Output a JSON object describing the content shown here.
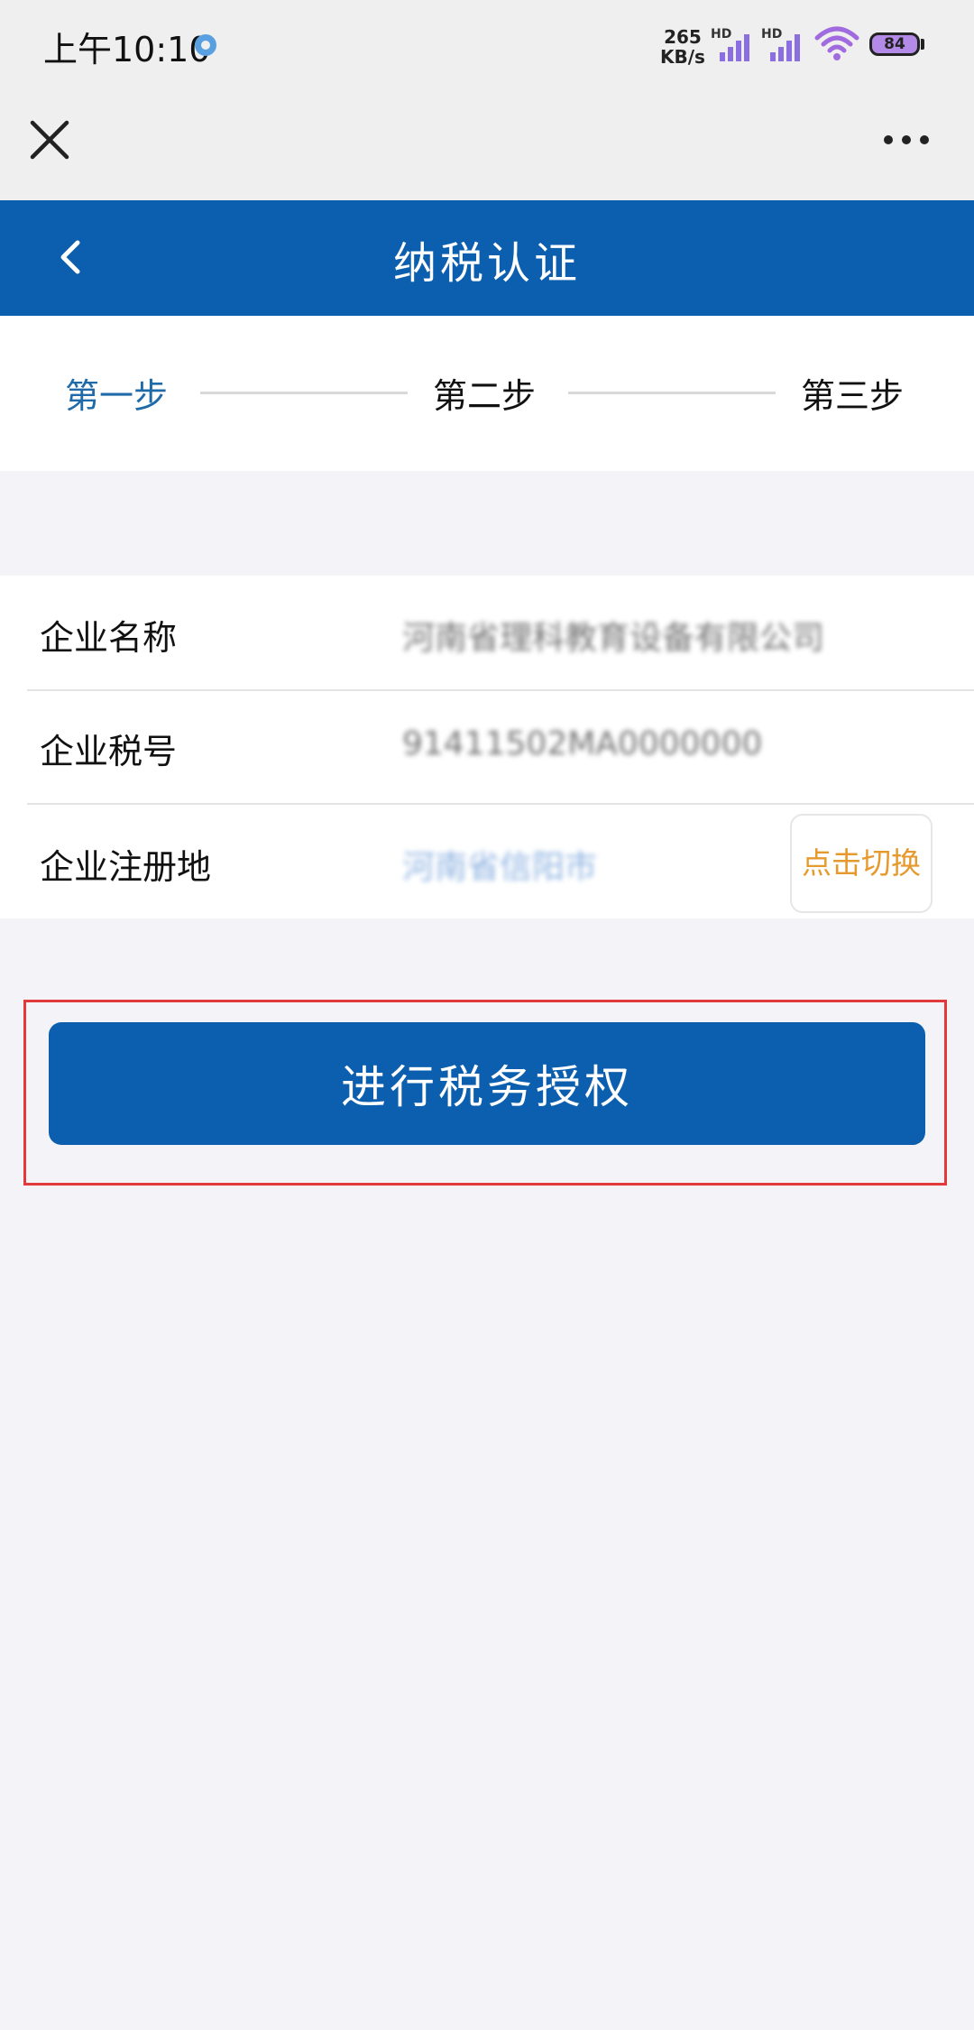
{
  "status_bar": {
    "time": "上午10:10",
    "net_speed_value": "265",
    "net_speed_unit": "KB/s",
    "sim1_label": "HD",
    "sim2_label": "HD",
    "battery": "84",
    "icons": [
      "location-icon",
      "signal-icon",
      "signal-icon",
      "wifi-icon",
      "battery-icon"
    ]
  },
  "mini_program_bar": {
    "icons": [
      "close-icon",
      "more-icon"
    ]
  },
  "header": {
    "title": "纳税认证",
    "icon": "back-icon"
  },
  "stepper": {
    "steps": [
      {
        "label": "第一步",
        "active": true
      },
      {
        "label": "第二步",
        "active": false
      },
      {
        "label": "第三步",
        "active": false
      }
    ]
  },
  "info": {
    "rows": [
      {
        "label": "企业名称",
        "value": "河南省理科教育设备有限公司"
      },
      {
        "label": "企业税号",
        "value": "91411502MA0000000"
      },
      {
        "label": "企业注册地",
        "value": "河南省信阳市"
      }
    ],
    "switch_label": "点击切换"
  },
  "action": {
    "authorize_label": "进行税务授权"
  },
  "colors": {
    "primary": "#0c5fae",
    "active_step": "#1f6aa8",
    "switch_text": "#e69a2e",
    "highlight": "#e23a3a",
    "page_bg": "#f3f3f8"
  }
}
